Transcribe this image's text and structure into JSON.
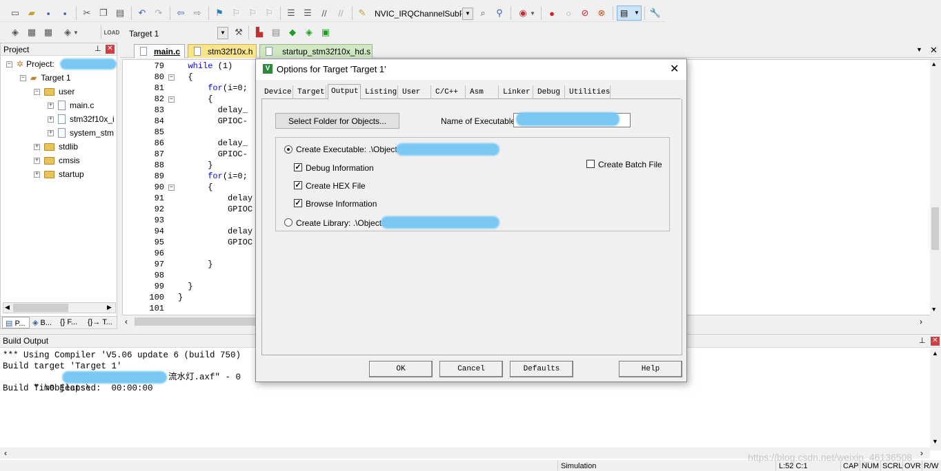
{
  "toolbar1": {
    "function_combo_value": "NVIC_IRQChannelSubPrio"
  },
  "toolbar2": {
    "target_combo_value": "Target 1"
  },
  "project_panel": {
    "title": "Project",
    "root_label": "Project:",
    "target_label": "Target 1",
    "user_folder": "user",
    "files": [
      "main.c",
      "stm32f10x_i",
      "system_stm"
    ],
    "folders": [
      "stdlib",
      "cmsis",
      "startup"
    ],
    "bottom_tabs": [
      "P...",
      "B...",
      "{} F...",
      "{}→ T..."
    ]
  },
  "editor": {
    "tabs": [
      "main.c",
      "stm32f10x.h",
      "startup_stm32f10x_hd.s"
    ],
    "active_tab": "main.c",
    "line_numbers": [
      "79",
      "80",
      "81",
      "82",
      "83",
      "84",
      "85",
      "86",
      "87",
      "88",
      "89",
      "90",
      "91",
      "92",
      "93",
      "94",
      "95",
      "96",
      "97",
      "98",
      "99",
      "100",
      "101"
    ],
    "lines": [
      "  while (1)",
      "  {",
      "      for(i=0;",
      "      {",
      "        delay_",
      "        GPIOC-",
      "",
      "        delay_",
      "        GPIOC-",
      "      }",
      "      for(i=0;",
      "      {",
      "          delay",
      "          GPIOC",
      "",
      "          delay",
      "          GPIOC",
      "",
      "      }",
      "",
      "  }",
      "}",
      ""
    ],
    "keyword_color": "#0000ff"
  },
  "build_output": {
    "title": "Build Output",
    "lines": [
      "*** Using Compiler 'V5.06 update 6 (build 750)",
      "Build target 'Target 1'",
      "\".\\Objects\\",
      "Build Time Elapsed:  00:00:00"
    ],
    "line3_tail": "流水灯.axf\" - 0"
  },
  "status_bar": {
    "mode": "Simulation",
    "position": "L:52 C:1",
    "indicators": [
      "CAP",
      "NUM",
      "SCRL",
      "OVR",
      "R/W"
    ],
    "watermark": "https://blog.csdn.net/weixin_46136508"
  },
  "dialog": {
    "title": "Options for Target 'Target 1'",
    "tabs": [
      "Device",
      "Target",
      "Output",
      "Listing",
      "User",
      "C/C++",
      "Asm",
      "Linker",
      "Debug",
      "Utilities"
    ],
    "active_tab": "Output",
    "select_folder_label": "Select Folder for Objects...",
    "name_exec_label": "Name of Executable:",
    "name_exec_value": "",
    "create_exec_label": "Create Executable:  .\\Objects\\",
    "debug_info_label": "Debug Information",
    "create_hex_label": "Create HEX File",
    "browse_info_label": "Browse Information",
    "create_batch_label": "Create Batch File",
    "create_lib_label": "Create Library:  .\\Objects\\",
    "ok_label": "OK",
    "cancel_label": "Cancel",
    "defaults_label": "Defaults",
    "help_label": "Help",
    "debug_info_checked": true,
    "create_hex_checked": true,
    "browse_info_checked": true,
    "create_batch_checked": false,
    "create_exec_selected": true
  }
}
